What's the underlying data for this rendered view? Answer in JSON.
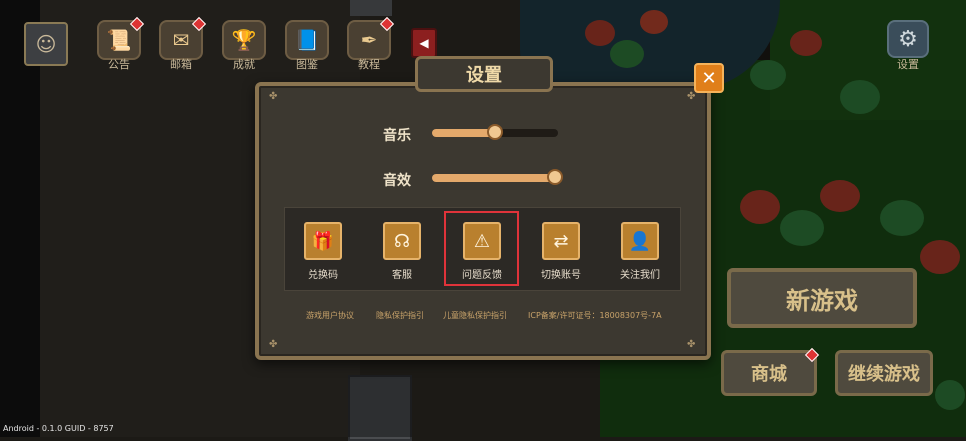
{
  "top_bar": {
    "items": [
      {
        "label": "公告",
        "icon": "scroll-icon",
        "badge": true
      },
      {
        "label": "邮箱",
        "icon": "mail-icon",
        "badge": true
      },
      {
        "label": "成就",
        "icon": "trophy-icon",
        "badge": false
      },
      {
        "label": "图鉴",
        "icon": "book-icon",
        "badge": false
      },
      {
        "label": "教程",
        "icon": "quill-icon",
        "badge": true
      }
    ],
    "settings_label": "设置"
  },
  "dialog": {
    "title": "设置",
    "music_label": "音乐",
    "music_level": 0.5,
    "sfx_label": "音效",
    "sfx_level": 0.98,
    "options": [
      {
        "label": "兑换码",
        "icon": "gift-icon"
      },
      {
        "label": "客服",
        "icon": "headset-icon"
      },
      {
        "label": "问题反馈",
        "icon": "warning-icon"
      },
      {
        "label": "切换账号",
        "icon": "swap-icon"
      },
      {
        "label": "关注我们",
        "icon": "add-user-icon"
      }
    ],
    "links": [
      "游戏用户协议",
      "隐私保护指引",
      "儿童隐私保护指引",
      "ICP备案/许可证号：18008307号-7A"
    ]
  },
  "main_buttons": {
    "new_game": "新游戏",
    "shop": "商城",
    "continue": "继续游戏"
  },
  "version_text": "Android - 0.1.0   GUID - 8757",
  "colors": {
    "accent_orange": "#e07f1a",
    "option_gold": "#b9802e",
    "highlight_red": "#e0333a",
    "slider_fill": "#e4a96b"
  }
}
